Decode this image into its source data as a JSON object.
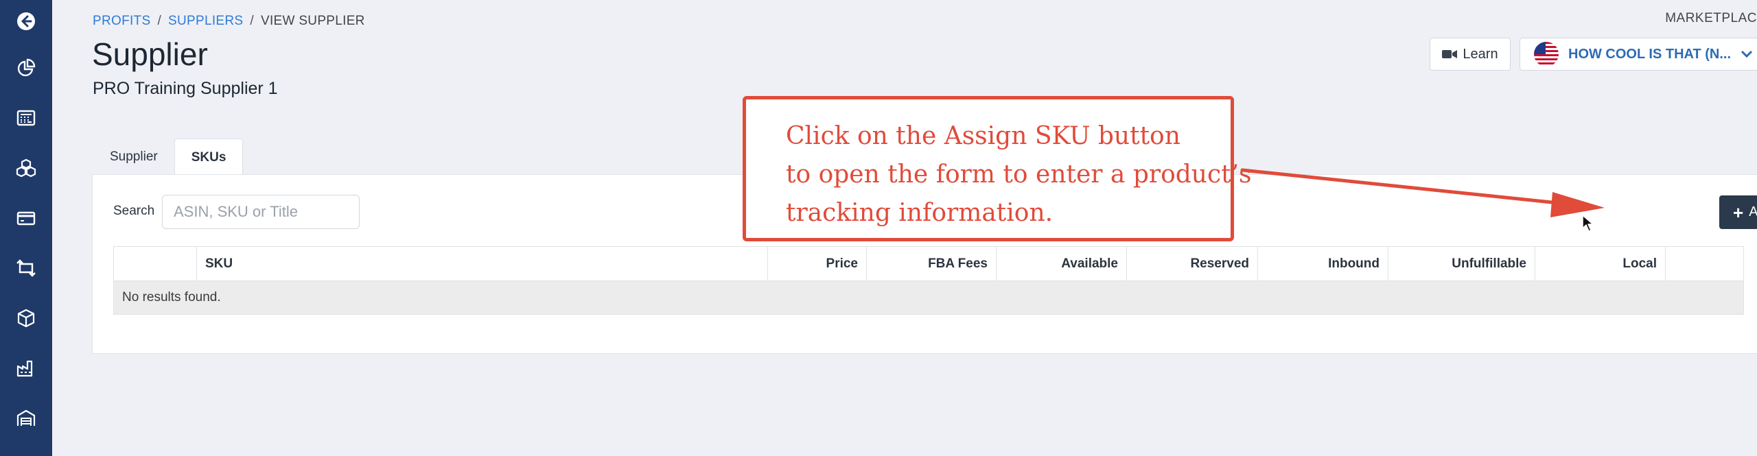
{
  "breadcrumb": {
    "item1": "PROFITS",
    "sep1": "/",
    "item2": "SUPPLIERS",
    "sep2": "/",
    "current": "VIEW SUPPLIER"
  },
  "page": {
    "title": "Supplier",
    "subtitle": "PRO Training Supplier 1"
  },
  "header": {
    "marketplace_label": "MARKETPLAC",
    "learn_label": "Learn",
    "marketplace_value": "HOW COOL IS THAT (N..."
  },
  "tabs": [
    {
      "label": "Supplier",
      "active": false
    },
    {
      "label": "SKUs",
      "active": true
    }
  ],
  "search": {
    "label": "Search",
    "placeholder": "ASIN, SKU or Title",
    "value": ""
  },
  "assign_button": {
    "label": "Assign SKU"
  },
  "table": {
    "columns": [
      "",
      "SKU",
      "Price",
      "FBA Fees",
      "Available",
      "Reserved",
      "Inbound",
      "Unfulfillable",
      "Local",
      ""
    ],
    "empty_message": "No results found."
  },
  "callout": {
    "line1": "Click on the Assign SKU button",
    "line2": "to open the form to enter a product’s",
    "line3": "tracking information."
  },
  "sidebar": {
    "icons": [
      "back-arrow-icon",
      "pie-chart-icon",
      "calculator-icon",
      "boxes-icon",
      "credit-card-icon",
      "repeat-icon",
      "package-icon",
      "factory-icon",
      "warehouse-icon"
    ]
  },
  "colors": {
    "sidebar": "#1f3a68",
    "link": "#2e7bd6",
    "button_dark": "#2a3a4c",
    "callout": "#e04b3a",
    "background": "#eef0f5"
  }
}
